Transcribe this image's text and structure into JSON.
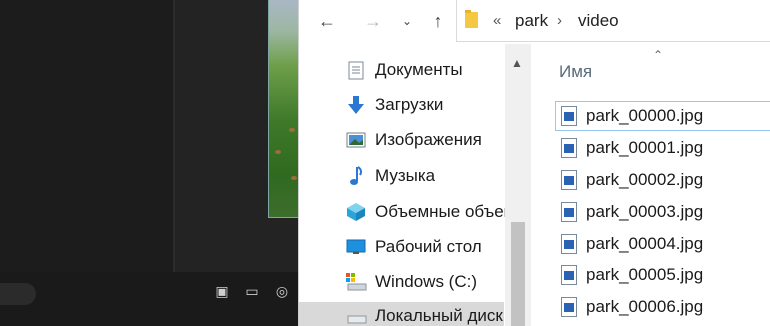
{
  "explorer": {
    "nav": {
      "back_icon": "arrow-left-icon",
      "forward_icon": "arrow-right-icon",
      "recent_icon": "chevron-down-icon",
      "up_icon": "arrow-up-icon"
    },
    "address": {
      "overflow": "«",
      "crumbs": [
        "park",
        "video"
      ],
      "separator": "›"
    },
    "nav_pane": {
      "items": [
        {
          "label": "Документы",
          "icon": "documents-icon"
        },
        {
          "label": "Загрузки",
          "icon": "downloads-icon"
        },
        {
          "label": "Изображения",
          "icon": "pictures-icon"
        },
        {
          "label": "Музыка",
          "icon": "music-icon"
        },
        {
          "label": "Объемные объекты",
          "icon": "3d-objects-icon"
        },
        {
          "label": "Рабочий стол",
          "icon": "desktop-icon"
        },
        {
          "label": "Windows (C:)",
          "icon": "drive-icon"
        },
        {
          "label": "Локальный диск",
          "icon": "drive-icon"
        }
      ]
    },
    "file_list": {
      "column_name": "Имя",
      "files": [
        "park_00000.jpg",
        "park_00001.jpg",
        "park_00002.jpg",
        "park_00003.jpg",
        "park_00004.jpg",
        "park_00005.jpg",
        "park_00006.jpg"
      ]
    }
  },
  "colors": {
    "selection": "#d9d9d9",
    "focus_outline": "#99c9ef",
    "folder": "#f4c842",
    "editor_bg": "#1e1e1e"
  }
}
